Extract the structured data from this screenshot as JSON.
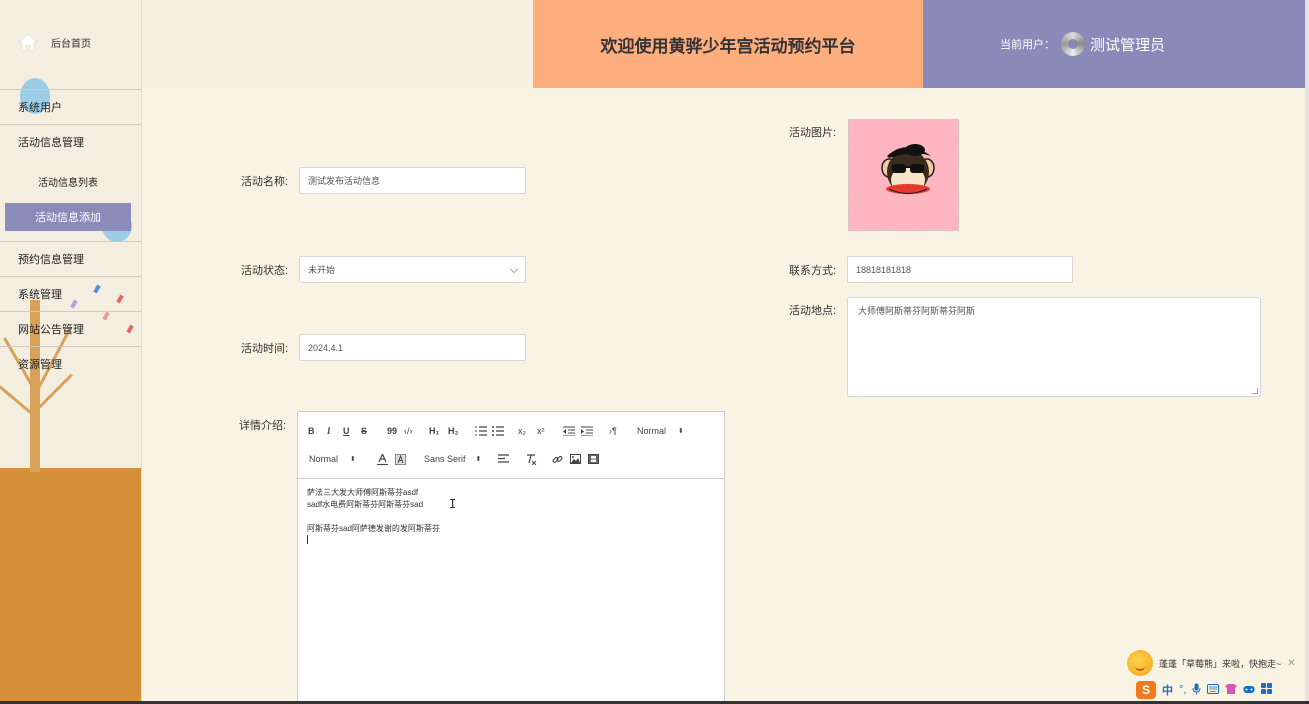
{
  "sidebar": {
    "home": "后台首页",
    "items": [
      {
        "label": "系统用户"
      },
      {
        "label": "活动信息管理"
      },
      {
        "label": "活动信息列表"
      },
      {
        "label": "活动信息添加"
      },
      {
        "label": "预约信息管理"
      },
      {
        "label": "系统管理"
      },
      {
        "label": "网站公告管理"
      },
      {
        "label": "资源管理"
      }
    ]
  },
  "header": {
    "title": "欢迎使用黄骅少年宫活动预约平台",
    "current_user_label": "当前用户：",
    "username": "测试管理员"
  },
  "form": {
    "name_label": "活动名称:",
    "name_value": "测试发布活动信息",
    "status_label": "活动状态:",
    "status_value": "未开始",
    "time_label": "活动时间:",
    "time_value": "2024.4.1",
    "detail_label": "详情介绍:",
    "image_label": "活动图片:",
    "contact_label": "联系方式:",
    "contact_value": "18818181818",
    "location_label": "活动地点:",
    "location_value": "大师傅阿斯蒂芬阿斯蒂芬阿斯"
  },
  "editor": {
    "toolbar": {
      "bold": "B",
      "italic": "I",
      "underline": "U",
      "strike": "S",
      "quote": "99",
      "code": "‹/›",
      "h1": "H₁",
      "h2": "H₂",
      "sub": "x₂",
      "sup": "x²",
      "rtl": "›¶",
      "size_picker": "Normal",
      "header_picker": "Normal",
      "font_picker": "Sans Serif"
    },
    "lines": [
      "萨法三大发大师傅阿斯蒂芬asdf",
      "sadf水电费阿斯蒂芬阿斯蒂芬sad",
      "",
      "阿斯蒂芬sad阿萨德发谢的发阿斯蒂芬"
    ]
  },
  "ime": {
    "tip": "蓬蓬「草莓熊」来啦，快抱走~",
    "logo": "S",
    "lang": "中",
    "punct": "°,"
  },
  "colors": {
    "accent_purple": "#8a8ab8",
    "header_orange": "#fdae7f",
    "sidebar_orange": "#d58f39",
    "page_bg": "#f9f3e3"
  }
}
